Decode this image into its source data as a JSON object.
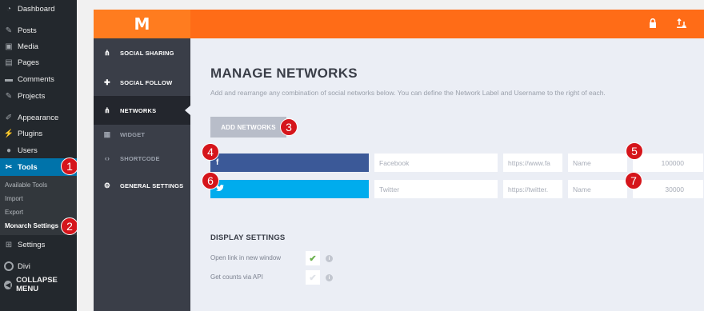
{
  "wp_sidebar": {
    "items": [
      {
        "label": "Dashboard",
        "icon": "dashboard-icon",
        "glyph": "◔"
      },
      {
        "label": "Posts",
        "icon": "pin-icon",
        "glyph": "✎"
      },
      {
        "label": "Media",
        "icon": "media-icon",
        "glyph": "▣"
      },
      {
        "label": "Pages",
        "icon": "pages-icon",
        "glyph": "▤"
      },
      {
        "label": "Comments",
        "icon": "comments-icon",
        "glyph": "▬"
      },
      {
        "label": "Projects",
        "icon": "pin-icon",
        "glyph": "✎"
      },
      {
        "label": "Appearance",
        "icon": "brush-icon",
        "glyph": "✐"
      },
      {
        "label": "Plugins",
        "icon": "plugin-icon",
        "glyph": "⚡"
      },
      {
        "label": "Users",
        "icon": "user-icon",
        "glyph": "●"
      },
      {
        "label": "Tools",
        "icon": "wrench-icon",
        "glyph": "✂"
      },
      {
        "label": "Settings",
        "icon": "settings-icon",
        "glyph": "⊞"
      },
      {
        "label": "Divi",
        "icon": "divi-icon",
        "glyph": ""
      }
    ],
    "submenu": [
      "Available Tools",
      "Import",
      "Export",
      "Monarch Settings"
    ],
    "collapse_label": "COLLAPSE MENU"
  },
  "header": {
    "logo": "M",
    "icons": [
      {
        "name": "lock-icon",
        "glyph": "🔒"
      },
      {
        "name": "import-export-icon",
        "glyph": "⇅"
      }
    ]
  },
  "nav": {
    "items": [
      {
        "label": "SOCIAL SHARING",
        "icon": "share-icon",
        "glyph": "⋔"
      },
      {
        "label": "SOCIAL FOLLOW",
        "icon": "plus-icon",
        "glyph": "✚"
      },
      {
        "label": "NETWORKS",
        "icon": "share-icon",
        "glyph": "⋔"
      },
      {
        "label": "WIDGET",
        "icon": "grid-icon",
        "glyph": "▦"
      },
      {
        "label": "SHORTCODE",
        "icon": "code-icon",
        "glyph": "‹›"
      },
      {
        "label": "GENERAL SETTINGS",
        "icon": "gear-icon",
        "glyph": "⚙"
      }
    ]
  },
  "main": {
    "title": "MANAGE NETWORKS",
    "description": "Add and rearrange any combination of social networks below. You can define the Network Label and Username to the right of each.",
    "add_button": "ADD NETWORKS",
    "networks": [
      {
        "glyph": "f",
        "color": "#3b5998",
        "label_placeholder": "Facebook",
        "url": "https://www.fa",
        "name": "Name",
        "count": "100000"
      },
      {
        "glyph": "🐦",
        "color": "#00aced",
        "label_placeholder": "Twitter",
        "url": "https://twitter.",
        "name": "Name",
        "count": "30000"
      }
    ],
    "display_settings": {
      "title": "DISPLAY SETTINGS",
      "options": [
        {
          "label": "Open link in new window",
          "checked": true
        },
        {
          "label": "Get counts via API",
          "checked": false
        }
      ],
      "check_glyph": "✔",
      "info_glyph": "i"
    }
  },
  "badges": [
    "1",
    "2",
    "3",
    "4",
    "5",
    "6",
    "7"
  ],
  "colors": {
    "accent": "#ff6c17",
    "wp_active": "#0073aa",
    "badge": "#d5151b",
    "check_on": "#6ab04c",
    "check_off": "#dfe2e8"
  }
}
